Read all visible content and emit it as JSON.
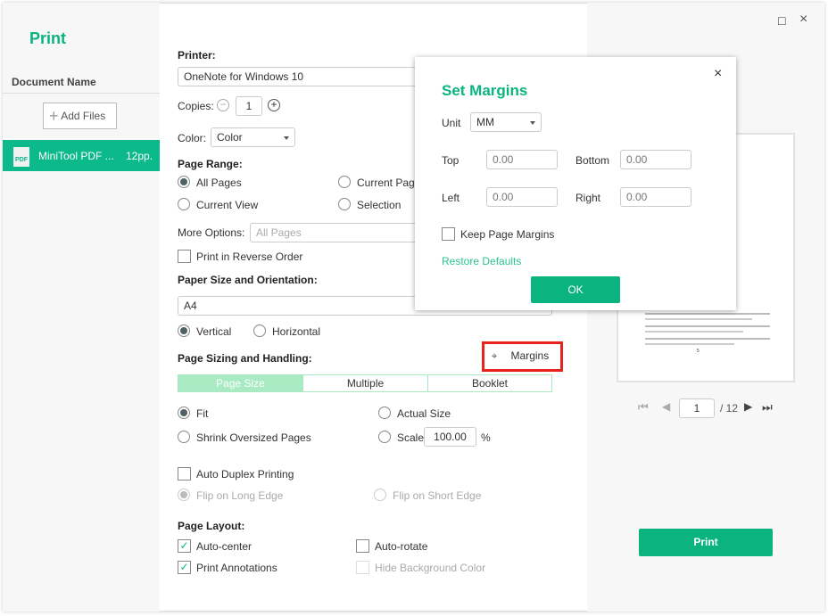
{
  "window": {
    "controls": {
      "maximize": "□",
      "close": "×"
    }
  },
  "sidebar": {
    "title": "Print",
    "column_header": "Document Name",
    "add_files": "Add Files",
    "file": {
      "name": "MiniTool PDF ...",
      "pages": "12pp.",
      "icon_label": "PDF"
    }
  },
  "settings": {
    "printer_label": "Printer:",
    "printer_value": "OneNote for Windows 10",
    "copies_label": "Copies:",
    "copies_value": "1",
    "color_label": "Color:",
    "color_value": "Color",
    "page_range_label": "Page Range:",
    "range_options": [
      {
        "label": "All Pages",
        "selected": true
      },
      {
        "label": "Current Page",
        "selected": false
      },
      {
        "label": "Current View",
        "selected": false
      },
      {
        "label": "Selection",
        "selected": false
      }
    ],
    "more_options_label": "More Options:",
    "more_options_value": "All Pages",
    "reverse_order": {
      "label": "Print in Reverse Order",
      "checked": false
    },
    "paper_label": "Paper Size and Orientation:",
    "paper_value": "A4",
    "orientation": [
      {
        "label": "Vertical",
        "selected": true
      },
      {
        "label": "Horizontal",
        "selected": false
      }
    ],
    "sizing_label": "Page Sizing and Handling:",
    "margins_button": "Margins",
    "tabs": [
      {
        "label": "Page Size",
        "active": true
      },
      {
        "label": "Multiple",
        "active": false
      },
      {
        "label": "Booklet",
        "active": false
      }
    ],
    "sizing_options": [
      {
        "label": "Fit",
        "selected": true
      },
      {
        "label": "Actual Size",
        "selected": false
      },
      {
        "label": "Shrink Oversized Pages",
        "selected": false
      },
      {
        "label": "Scale",
        "selected": false
      }
    ],
    "scale_value": "100.00",
    "scale_unit": "%",
    "duplex": {
      "label": "Auto Duplex Printing",
      "checked": false
    },
    "flip": [
      {
        "label": "Flip on Long Edge",
        "selected": true,
        "disabled": true
      },
      {
        "label": "Flip on Short Edge",
        "selected": false,
        "disabled": true
      }
    ],
    "layout_label": "Page Layout:",
    "layout_options": [
      {
        "label": "Auto-center",
        "checked": true
      },
      {
        "label": "Auto-rotate",
        "checked": false
      },
      {
        "label": "Print Annotations",
        "checked": true
      },
      {
        "label": "Hide Background Color",
        "checked": false,
        "disabled": true
      }
    ]
  },
  "dialog": {
    "title": "Set Margins",
    "unit_label": "Unit",
    "unit_value": "MM",
    "top_label": "Top",
    "top_value": "0.00",
    "bottom_label": "Bottom",
    "bottom_value": "0.00",
    "left_label": "Left",
    "left_value": "0.00",
    "right_label": "Right",
    "right_value": "0.00",
    "keep_label": "Keep Page Margins",
    "keep_checked": false,
    "restore_label": "Restore Defaults",
    "ok_label": "OK",
    "close": "×"
  },
  "preview": {
    "current_page": "1",
    "total": "/ 12",
    "page_footer": "5"
  },
  "print_button": "Print",
  "colors": {
    "accent": "#0bb47f",
    "highlight": "#e8231d",
    "tab_active": "#a8ebc3"
  }
}
